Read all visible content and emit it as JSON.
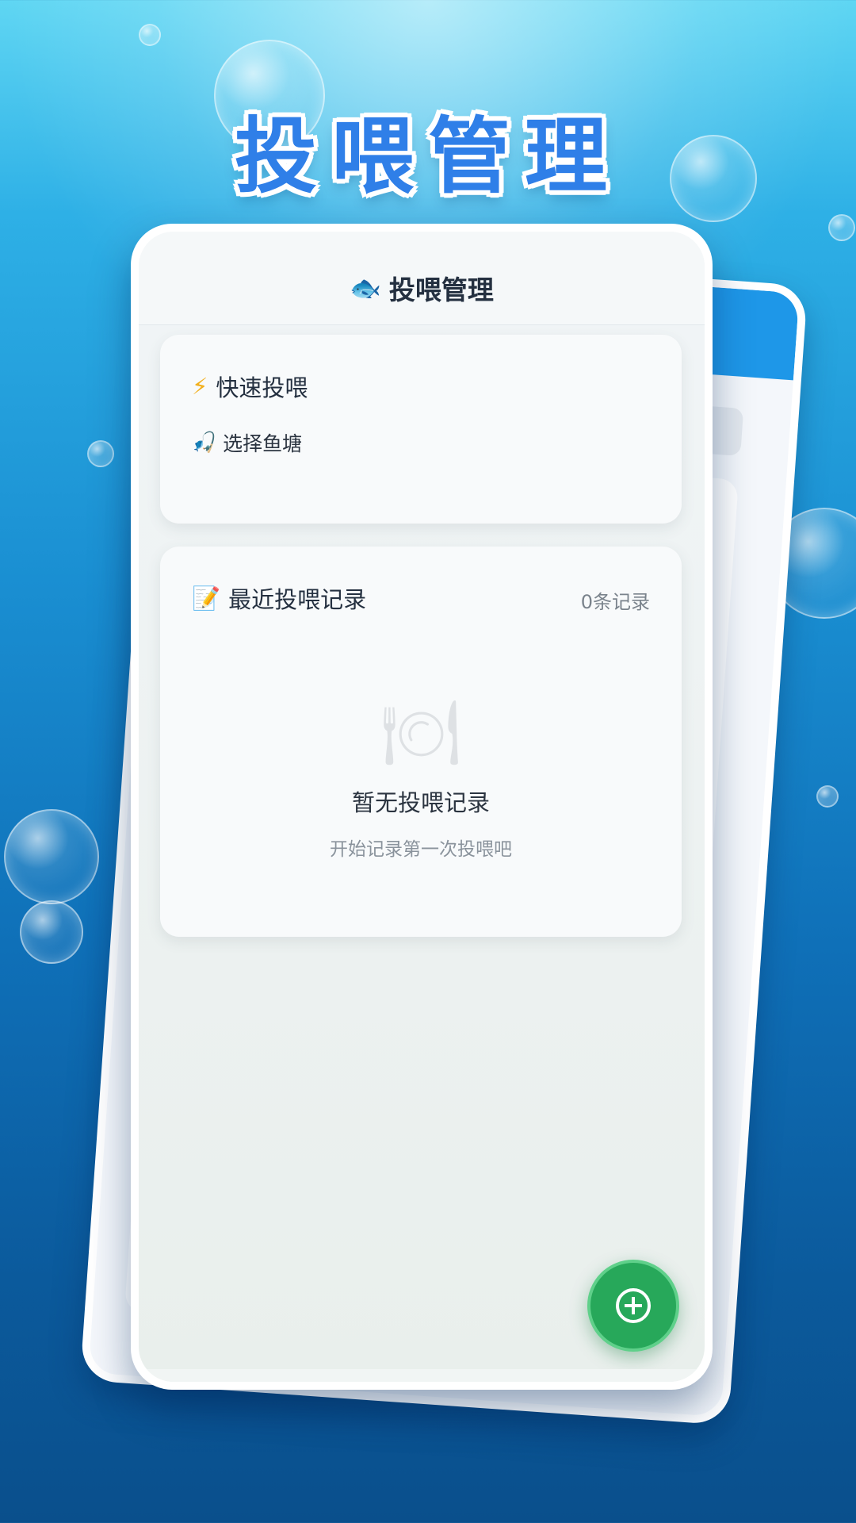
{
  "banner": {
    "title": "投喂管理"
  },
  "app": {
    "header_title": "投喂管理",
    "header_icon": "fish-icon"
  },
  "quick_feed": {
    "title": "快速投喂",
    "title_icon": "lightning-icon",
    "select_pond_label": "选择鱼塘",
    "select_pond_icon": "fishing-rod-icon"
  },
  "recent_records": {
    "title": "最近投喂记录",
    "title_icon": "memo-icon",
    "count_label": "0条记录",
    "empty_icon": "fork-knife-plate-icon",
    "empty_title": "暂无投喂记录",
    "empty_subtitle": "开始记录第一次投喂吧"
  },
  "fab": {
    "icon": "plus-circle-icon"
  },
  "colors": {
    "banner_text": "#2f7fe8",
    "fab_green": "#27a85a",
    "back_phone_header": "#1e97e8"
  }
}
